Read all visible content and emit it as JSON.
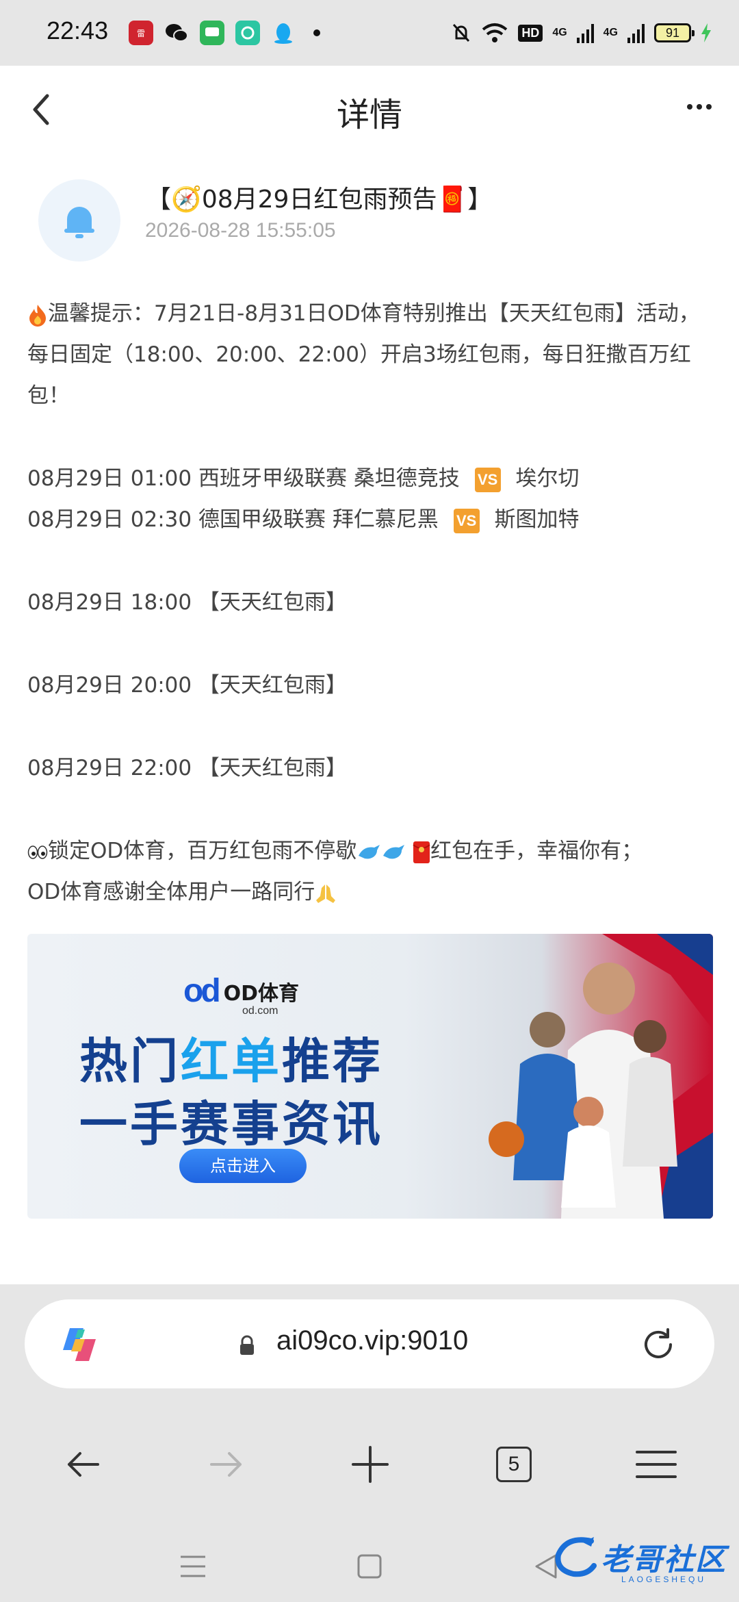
{
  "status_bar": {
    "time": "22:43",
    "network_1": "4G",
    "network_2": "4G",
    "hd_label": "HD",
    "battery": "91"
  },
  "header": {
    "title": "详情"
  },
  "message": {
    "title": "【🧭08月29日红包雨预告🧧】",
    "timestamp": "2026-08-28 15:55:05",
    "notice_line": "温馨提示：7月21日-8月31日OD体育特别推出【天天红包雨】活动，每日固定（18:00、20:00、22:00）开启3场红包雨，每日狂撒百万红包！",
    "matches": [
      {
        "time": "08月29日 01:00",
        "league": "西班牙甲级联赛",
        "home": "桑坦德竞技",
        "vs": "VS",
        "away": "埃尔切"
      },
      {
        "time": "08月29日 02:30",
        "league": "德国甲级联赛",
        "home": "拜仁慕尼黑",
        "vs": "VS",
        "away": "斯图加特"
      }
    ],
    "rain_events": [
      "08月29日 18:00 【天天红包雨】",
      "08月29日 20:00 【天天红包雨】",
      "08月29日 22:00 【天天红包雨】"
    ],
    "closing_part1": "锁定OD体育，百万红包雨不停歇",
    "closing_part2": "红包在手，幸福你有；",
    "closing_part3": "OD体育感谢全体用户一路同行"
  },
  "banner": {
    "logo_brand": "OD体育",
    "logo_domain": "od.com",
    "line1_dark_a": "热门",
    "line1_light": "红单",
    "line1_dark_b": "推荐",
    "line2": "一手赛事资讯",
    "button_label": "点击进入"
  },
  "browser": {
    "url": "ai09co.vip:9010",
    "tab_count": "5"
  },
  "watermark": {
    "text": "老哥社区",
    "sub": "LAOGESHEQU"
  },
  "colors": {
    "accent_blue": "#1a57d6",
    "vs_badge": "#f3a02f",
    "banner_red": "#c8102e"
  }
}
